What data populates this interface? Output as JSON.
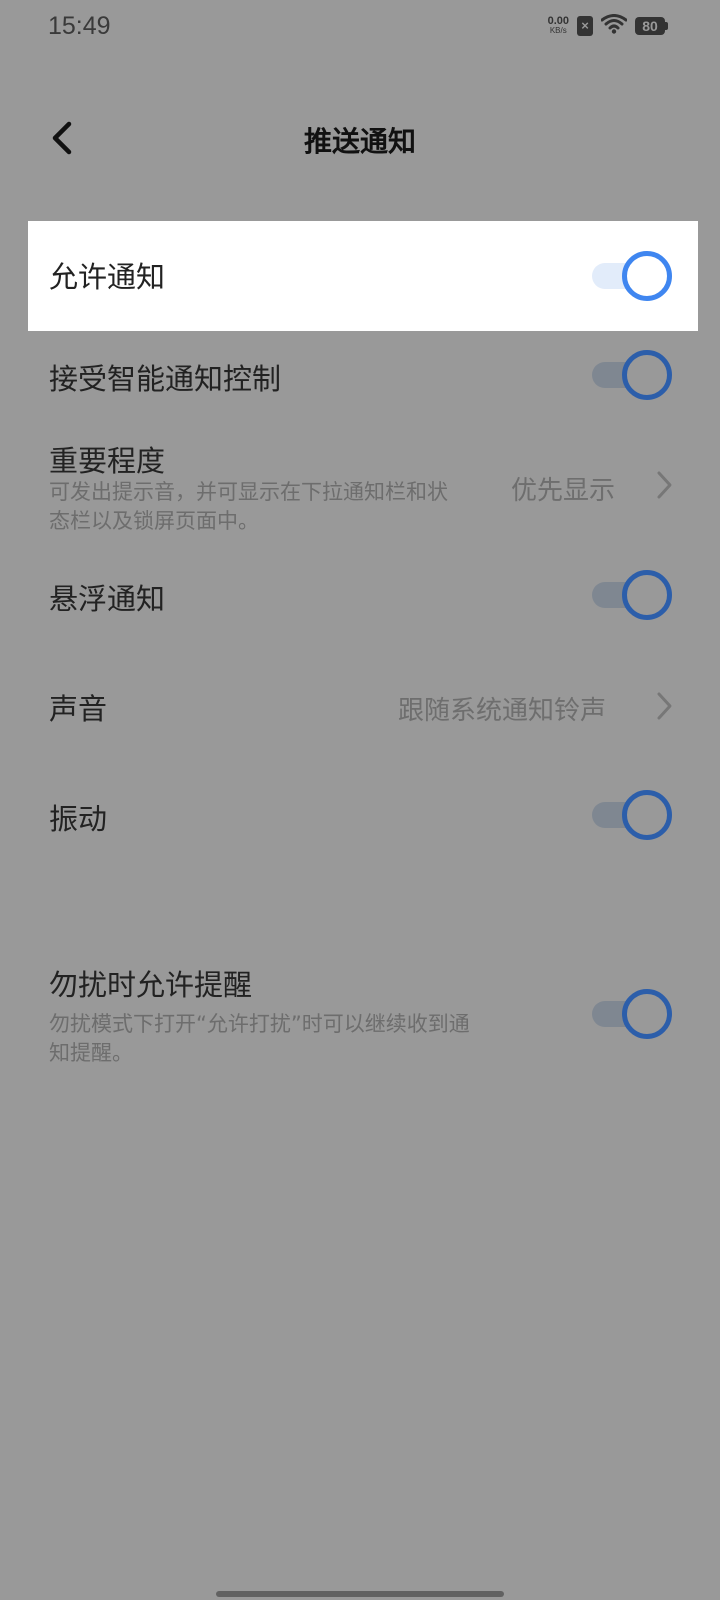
{
  "status_bar": {
    "time": "15:49",
    "net_speed_value": "0.00",
    "net_speed_unit": "KB/s",
    "battery": "80"
  },
  "header": {
    "title": "推送通知",
    "back_icon": "chevron-left-icon"
  },
  "settings": {
    "allow_notifications": {
      "label": "允许通知",
      "enabled": true
    },
    "smart_control": {
      "label": "接受智能通知控制",
      "enabled": true
    },
    "importance": {
      "label": "重要程度",
      "desc_line1": "可发出提示音，并可显示在下拉通知栏和状",
      "desc_line2": "态栏以及锁屏页面中。",
      "value": "优先显示"
    },
    "floating": {
      "label": "悬浮通知",
      "enabled": true
    },
    "sound": {
      "label": "声音",
      "value": "跟随系统通知铃声"
    },
    "vibration": {
      "label": "振动",
      "enabled": true
    },
    "dnd_reminder": {
      "label": "勿扰时允许提醒",
      "desc_line1": "勿扰模式下打开“允许打扰”时可以继续收到通",
      "desc_line2": "知提醒。",
      "enabled": true
    }
  },
  "colors": {
    "overlay_background": "#999999",
    "toggle_knob_active": "#3f86f0",
    "toggle_knob_dim": "#2c5eaa"
  }
}
